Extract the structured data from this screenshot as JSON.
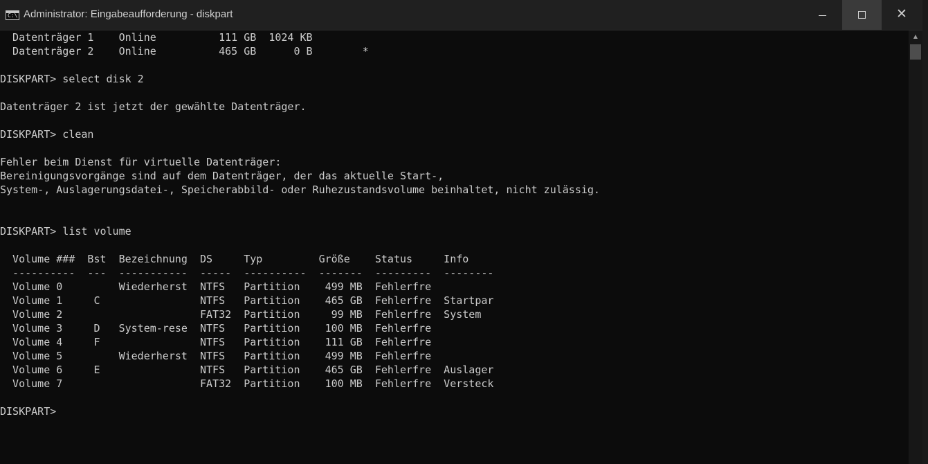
{
  "window": {
    "title": "Administrator: Eingabeaufforderung - diskpart",
    "app_icon_glyph": "C:\\",
    "minimize_glyph": "—",
    "maximize_glyph": "☐",
    "close_glyph": "✕"
  },
  "scrollbar": {
    "up_glyph": "▲"
  },
  "colors": {
    "console_background": "#0c0c0c",
    "console_text": "#cccccc",
    "titlebar": "#202020",
    "maximize_hover": "#3a3a3a"
  },
  "console": {
    "lines": [
      "  Datenträger 1    Online          111 GB  1024 KB",
      "  Datenträger 2    Online          465 GB      0 B        *",
      "",
      "DISKPART> select disk 2",
      "",
      "Datenträger 2 ist jetzt der gewählte Datenträger.",
      "",
      "DISKPART> clean",
      "",
      "Fehler beim Dienst für virtuelle Datenträger:",
      "Bereinigungsvorgänge sind auf dem Datenträger, der das aktuelle Start-,",
      "System-, Auslagerungsdatei-, Speicherabbild- oder Ruhezustandsvolume beinhaltet, nicht zulässig.",
      "",
      "",
      "DISKPART> list volume",
      "",
      "  Volume ###  Bst  Bezeichnung  DS     Typ         Größe    Status     Info",
      "  ----------  ---  -----------  -----  ----------  -------  ---------  --------",
      "  Volume 0         Wiederherst  NTFS   Partition    499 MB  Fehlerfre",
      "  Volume 1     C                NTFS   Partition    465 GB  Fehlerfre  Startpar",
      "  Volume 2                      FAT32  Partition     99 MB  Fehlerfre  System",
      "  Volume 3     D   System-rese  NTFS   Partition    100 MB  Fehlerfre",
      "  Volume 4     F                NTFS   Partition    111 GB  Fehlerfre",
      "  Volume 5         Wiederherst  NTFS   Partition    499 MB  Fehlerfre",
      "  Volume 6     E                NTFS   Partition    465 GB  Fehlerfre  Auslager",
      "  Volume 7                      FAT32  Partition    100 MB  Fehlerfre  Versteck",
      "",
      "DISKPART> "
    ]
  }
}
